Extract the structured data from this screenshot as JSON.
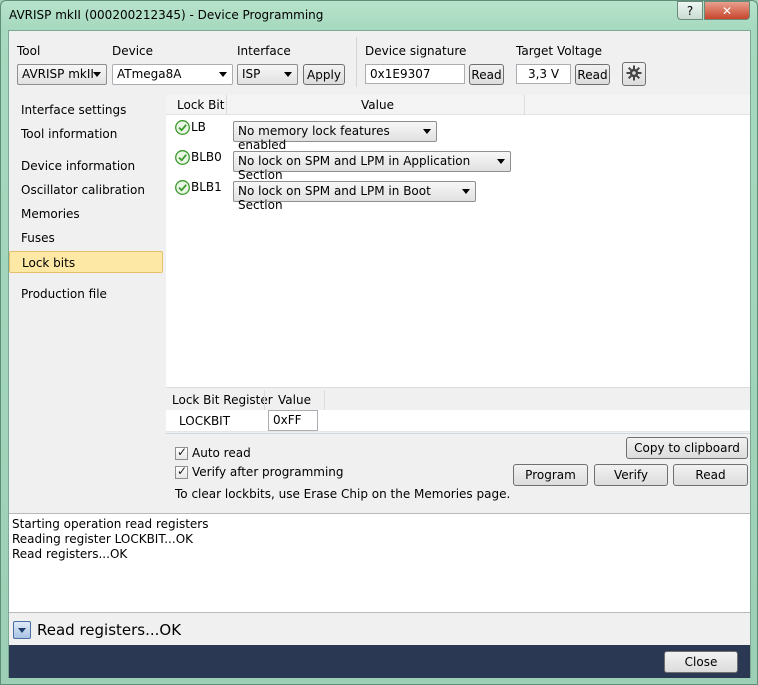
{
  "window": {
    "title": "AVRISP mkII (000200212345) - Device Programming",
    "help_label": "?",
    "close_label": "✕"
  },
  "toolbar": {
    "tool_label": "Tool",
    "tool_value": "AVRISP mkII",
    "device_label": "Device",
    "device_value": "ATmega8A",
    "interface_label": "Interface",
    "interface_value": "ISP",
    "apply_label": "Apply",
    "signature_label": "Device signature",
    "signature_value": "0x1E9307",
    "signature_read_label": "Read",
    "voltage_label": "Target Voltage",
    "voltage_value": "3,3 V",
    "voltage_read_label": "Read",
    "settings_icon": "gear-icon"
  },
  "sidebar": {
    "items": [
      {
        "label": "Interface settings"
      },
      {
        "label": "Tool information"
      },
      {
        "label": "Device information"
      },
      {
        "label": "Oscillator calibration"
      },
      {
        "label": "Memories"
      },
      {
        "label": "Fuses"
      },
      {
        "label": "Lock bits",
        "active": true
      },
      {
        "label": "Production file"
      }
    ]
  },
  "lockbits": {
    "col_lockbit": "Lock Bit",
    "col_value": "Value",
    "rows": [
      {
        "name": "LB",
        "value": "No memory lock features enabled"
      },
      {
        "name": "BLB0",
        "value": "No lock on SPM and LPM in Application Section"
      },
      {
        "name": "BLB1",
        "value": "No lock on SPM and LPM in Boot Section"
      }
    ],
    "status_icon": "check-circle-icon"
  },
  "register": {
    "col_register": "Lock Bit Register",
    "col_value": "Value",
    "name": "LOCKBIT",
    "value": "0xFF"
  },
  "actions": {
    "auto_read_label": "Auto read",
    "auto_read_checked": true,
    "verify_label": "Verify after programming",
    "verify_checked": true,
    "copy_label": "Copy to clipboard",
    "program_label": "Program",
    "verify_button_label": "Verify",
    "read_label": "Read",
    "hint": "To clear lockbits, use Erase Chip on the Memories page."
  },
  "log": {
    "lines": [
      "Starting operation read registers",
      "Reading register LOCKBIT...OK",
      "Read registers...OK"
    ]
  },
  "status": {
    "text": "Read registers...OK"
  },
  "footer": {
    "close_label": "Close"
  },
  "colors": {
    "frame": "#a6d9bf",
    "selection": "#fde8a6",
    "footer": "#2b3853",
    "ok_green": "#3d9a2f"
  }
}
